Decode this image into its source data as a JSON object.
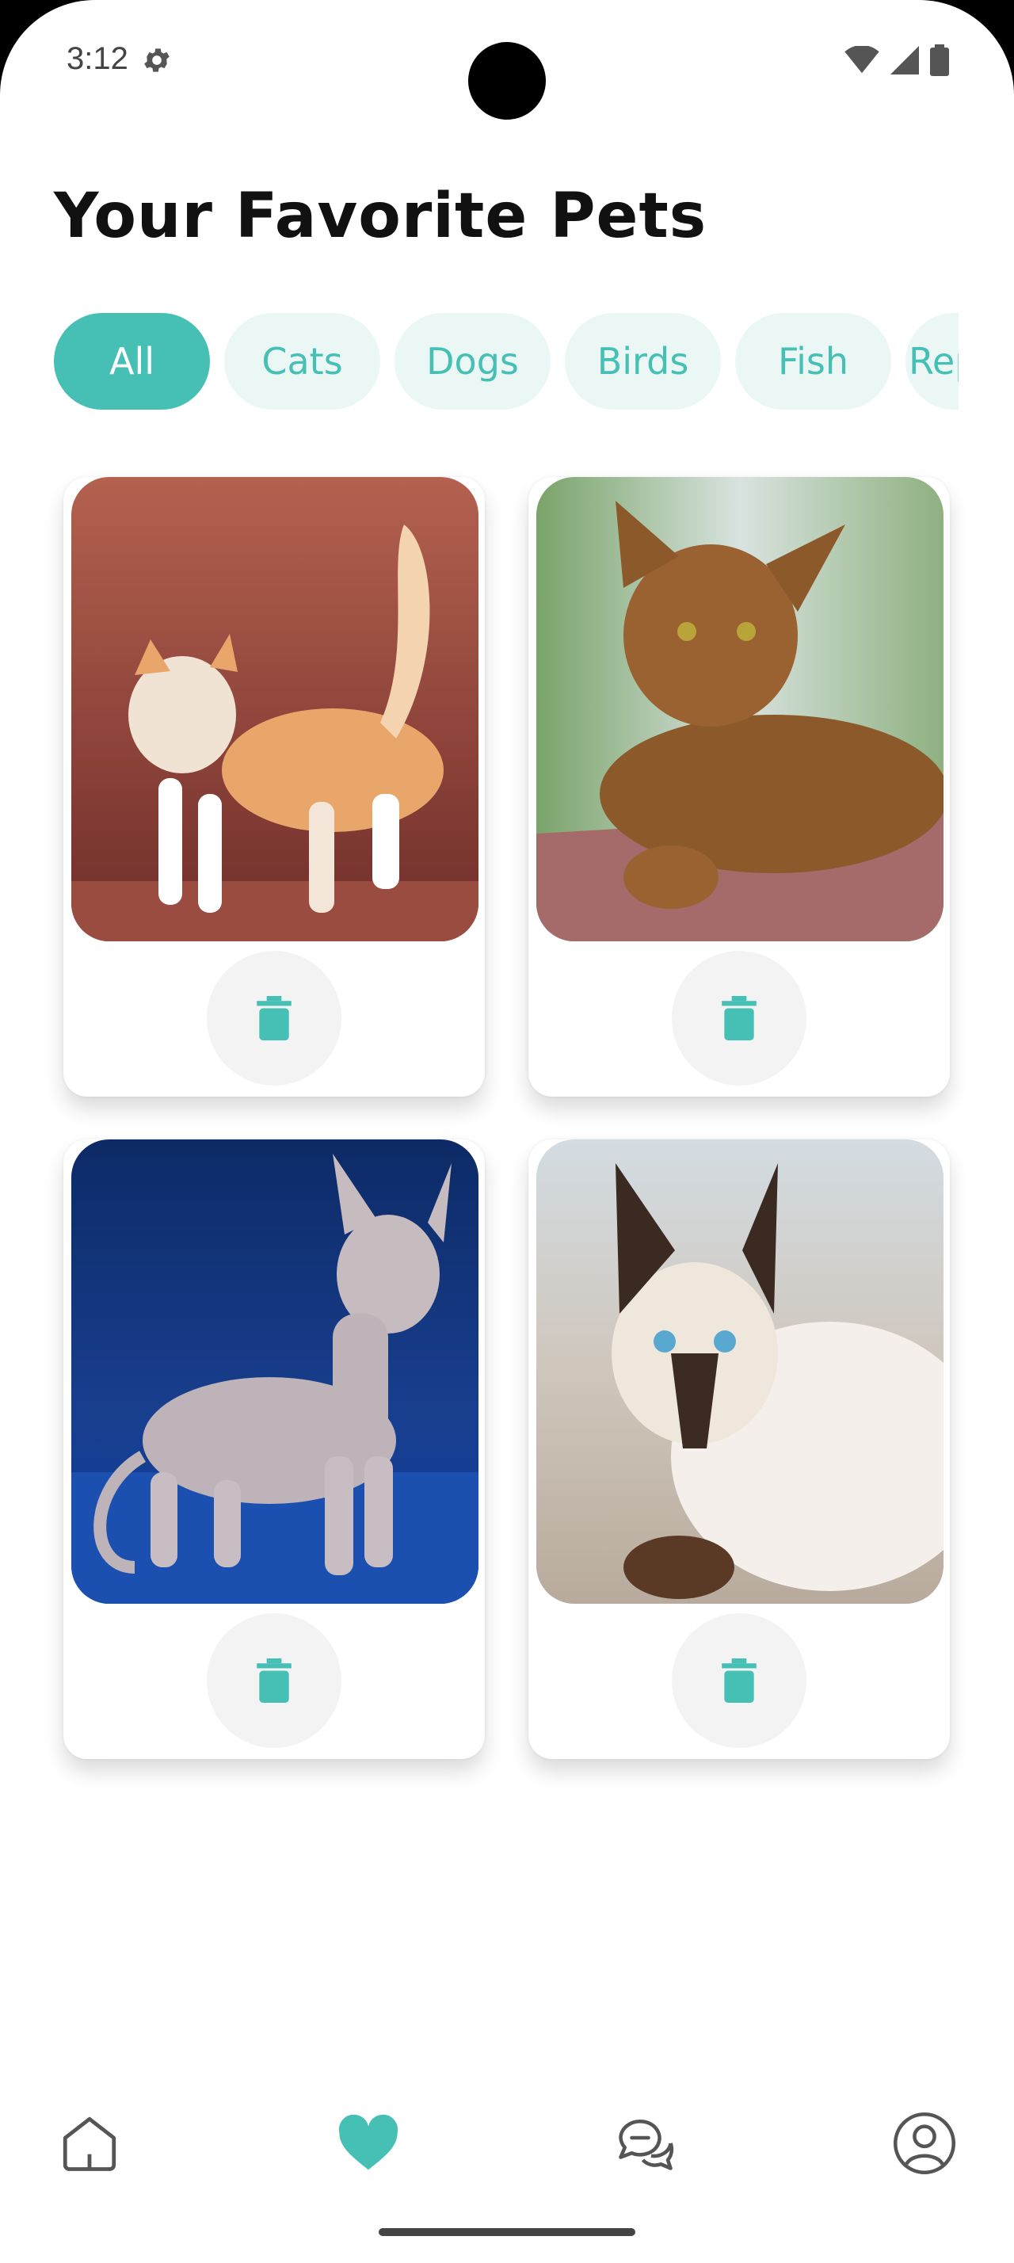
{
  "status_bar": {
    "time": "3:12",
    "icons": [
      "settings-gear-icon",
      "wifi-icon",
      "signal-icon",
      "battery-icon"
    ]
  },
  "page": {
    "title": "Your Favorite Pets"
  },
  "filters": [
    {
      "label": "All",
      "selected": true
    },
    {
      "label": "Cats",
      "selected": false
    },
    {
      "label": "Dogs",
      "selected": false
    },
    {
      "label": "Birds",
      "selected": false
    },
    {
      "label": "Fish",
      "selected": false
    },
    {
      "label": "Reptiles",
      "selected": false
    }
  ],
  "pets": [
    {
      "photo": "orange-white-curl-cat-photo",
      "action_icon": "trash-icon"
    },
    {
      "photo": "ruddy-abyssinian-cat-photo",
      "action_icon": "trash-icon"
    },
    {
      "photo": "sphynx-cat-photo",
      "action_icon": "trash-icon"
    },
    {
      "photo": "siamese-cat-photo",
      "action_icon": "trash-icon"
    }
  ],
  "bottom_nav": {
    "items": [
      "home-icon",
      "favorites-heart-icon",
      "chat-icon",
      "profile-icon"
    ],
    "active": "favorites-heart-icon"
  },
  "colors": {
    "accent": "#46bfb4",
    "chip_bg": "#eaf7f5",
    "delete_bg": "#f3f3f3"
  }
}
